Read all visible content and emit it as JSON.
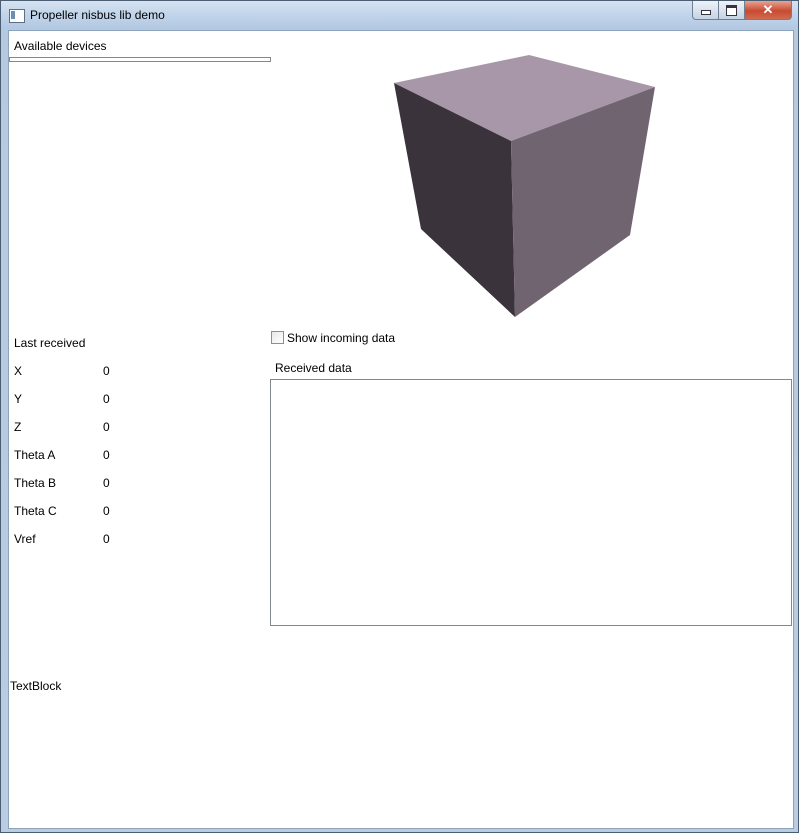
{
  "window": {
    "title": "Propeller nisbus lib demo",
    "close_glyph": "✕"
  },
  "devices": {
    "label": "Available devices"
  },
  "last_received": {
    "heading": "Last received",
    "rows": [
      {
        "label": "X",
        "value": "0"
      },
      {
        "label": "Y",
        "value": "0"
      },
      {
        "label": "Z",
        "value": "0"
      },
      {
        "label": "Theta A",
        "value": "0"
      },
      {
        "label": "Theta B",
        "value": "0"
      },
      {
        "label": "Theta C",
        "value": "0"
      },
      {
        "label": "Vref",
        "value": "0"
      }
    ]
  },
  "incoming": {
    "checkbox_label": "Show incoming data",
    "checked": false
  },
  "received": {
    "label": "Received data",
    "content": ""
  },
  "footer": {
    "textblock": "TextBlock"
  },
  "cube": {
    "top_color": "#a897a9",
    "left_color": "#3a333b",
    "right_color": "#716471"
  }
}
